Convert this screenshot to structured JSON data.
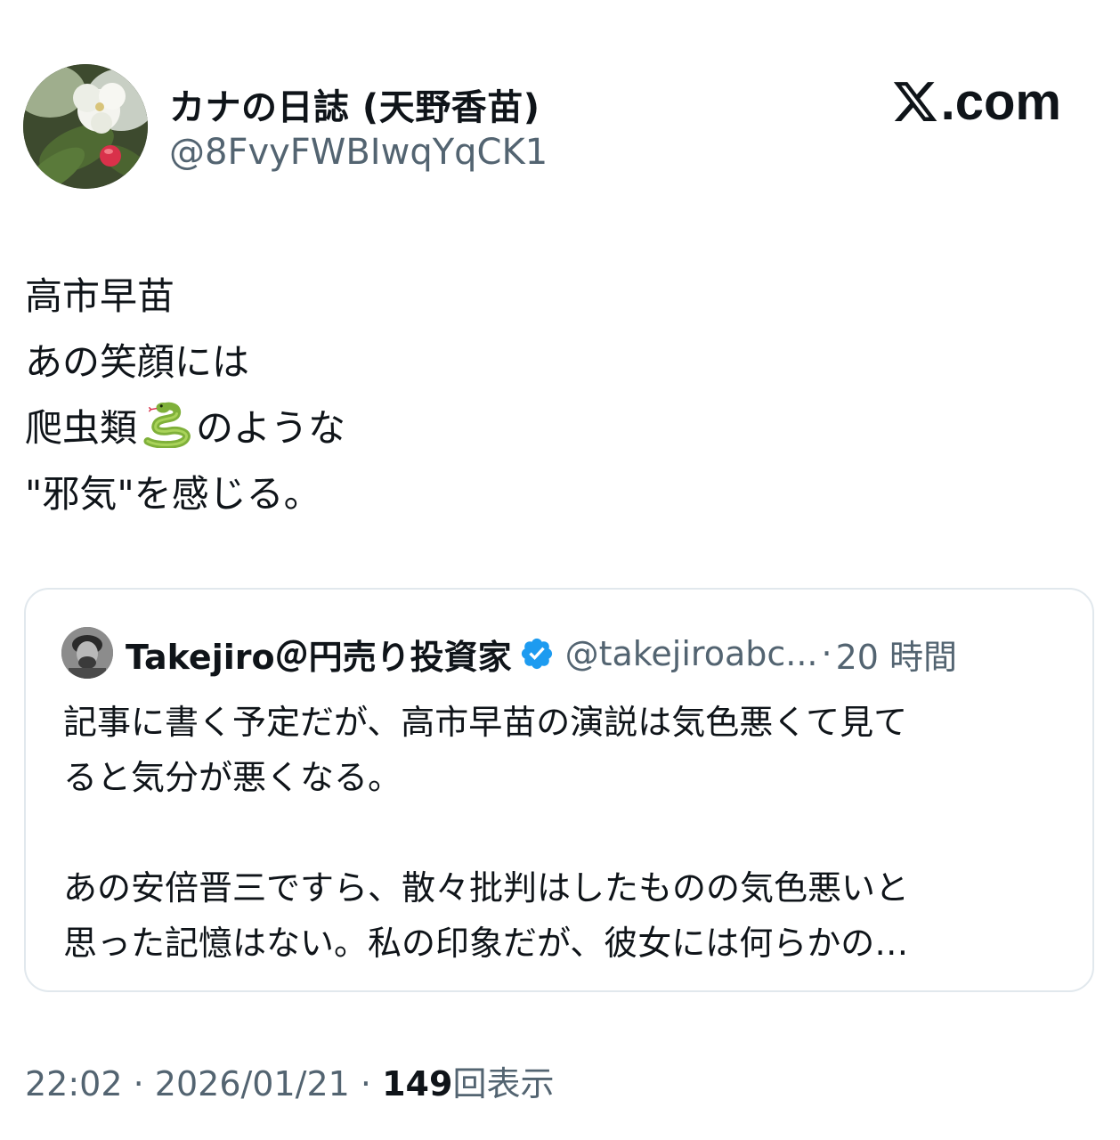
{
  "header": {
    "display_name": "カナの日誌 (天野香苗)",
    "handle": "@8FvyFWBIwqYqCK1",
    "brand_suffix": ".com",
    "brand_icon": "x-logo-icon"
  },
  "tweet": {
    "lines": [
      "高市早苗",
      "あの笑顔には",
      "爬虫類",
      "のような",
      "\"邪気\"を感じる。"
    ],
    "emoji": "snake-emoji"
  },
  "quote": {
    "name": "Takejiro＠円売り投資家",
    "handle": "@takejiroabc...",
    "separator": "·",
    "time": "20 時間",
    "verified_icon": "verified-badge-icon",
    "verified_color": "#1d9bf0",
    "text_lines": [
      "記事に書く予定だが、高市早苗の演説は気色悪くて見て",
      "ると気分が悪くなる。",
      "あの安倍晋三ですら、散々批判はしたものの気色悪いと",
      "思った記憶はない。私の印象だが、彼女には何らかの…"
    ]
  },
  "footer": {
    "time": "22:02",
    "sep1": "·",
    "date": "2026/01/21",
    "sep2": "·",
    "views_count": "149",
    "views_label": "回表示"
  },
  "colors": {
    "text_primary": "#0f1419",
    "text_secondary": "#536471",
    "border": "#e1e8ed"
  }
}
